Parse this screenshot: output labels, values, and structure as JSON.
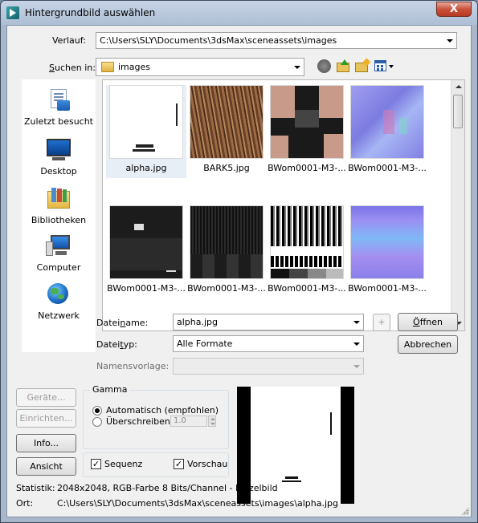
{
  "window": {
    "title": "Hintergrundbild auswählen",
    "close_label": "X"
  },
  "history": {
    "label": "Verlauf:",
    "value": "C:\\Users\\SLY\\Documents\\3dsMax\\sceneassets\\images"
  },
  "lookin": {
    "label": "Suchen in:",
    "value": "images"
  },
  "places": [
    {
      "label": "Zuletzt besucht",
      "icon": "recent-places-icon"
    },
    {
      "label": "Desktop",
      "icon": "desktop-icon"
    },
    {
      "label": "Bibliotheken",
      "icon": "libraries-icon"
    },
    {
      "label": "Computer",
      "icon": "computer-icon"
    },
    {
      "label": "Netzwerk",
      "icon": "network-icon"
    }
  ],
  "files": [
    {
      "name": "alpha.jpg",
      "selected": true
    },
    {
      "name": "BARK5.jpg"
    },
    {
      "name": "BWom0001-M3-..."
    },
    {
      "name": "BWom0001-M3-..."
    },
    {
      "name": "BWom0001-M3-..."
    },
    {
      "name": "BWom0001-M3-..."
    },
    {
      "name": "BWom0001-M3-..."
    },
    {
      "name": "BWom0001-M3-..."
    }
  ],
  "filename": {
    "label": "Dateiname:",
    "value": "alpha.jpg",
    "plus_label": "+"
  },
  "filetype": {
    "label": "Dateityp:",
    "value": "Alle Formate"
  },
  "template": {
    "label": "Namensvorlage:",
    "value": ""
  },
  "buttons": {
    "open": "Öffnen",
    "cancel": "Abbrechen",
    "devices": "Geräte...",
    "setup": "Einrichten...",
    "info": "Info...",
    "view": "Ansicht"
  },
  "gamma": {
    "title": "Gamma",
    "auto_label": "Automatisch (empfohlen)",
    "override_label": "Überschreiben",
    "override_value": "1.0"
  },
  "options": {
    "sequence_label": "Sequenz",
    "sequence_checked": true,
    "preview_label": "Vorschau",
    "preview_checked": true
  },
  "status": {
    "stats_label": "Statistik:",
    "stats_value": "2048x2048, RGB-Farbe 8 Bits/Channel - Einzelbild",
    "location_label": "Ort:",
    "location_value": "C:\\Users\\SLY\\Documents\\3dsMax\\sceneassets\\images\\alpha.jpg"
  }
}
